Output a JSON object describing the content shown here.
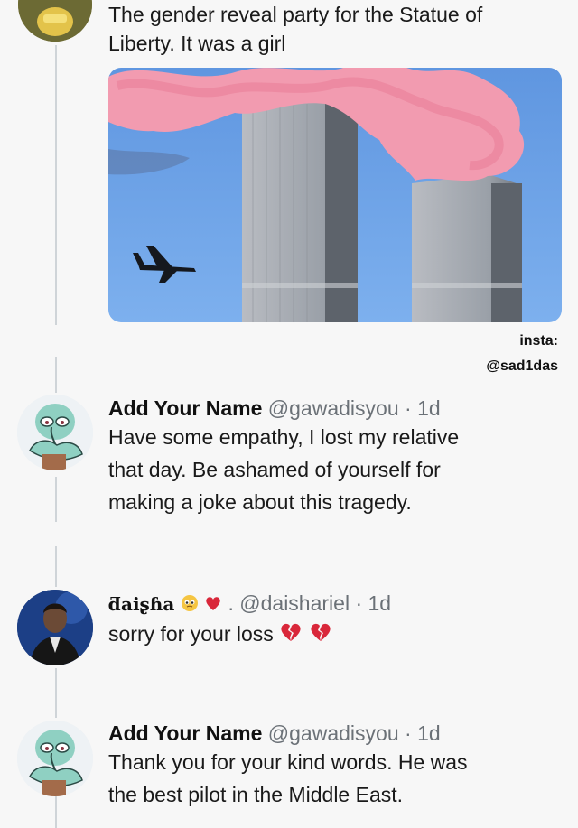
{
  "post": {
    "text_line1": "The gender reveal party for the Statue of",
    "text_line2": "Liberty. It was a girl",
    "image_alt": "twin towers with pink smoke and airplane"
  },
  "watermark": {
    "label": "insta:",
    "handle": "@sad1das"
  },
  "replies": [
    {
      "name": "Add Your Name",
      "handle": "@gawadisyou",
      "time": "· 1d",
      "lines": [
        "Have some empathy, I lost my relative",
        "that day.  Be ashamed of yourself for",
        "making a joke about this tragedy."
      ]
    },
    {
      "name": "ƌaiʂɦa",
      "handle": ". @daishariel",
      "time": "· 1d",
      "lines": [
        "sorry for your loss"
      ]
    },
    {
      "name": "Add Your Name",
      "handle": "@gawadisyou",
      "time": "· 1d",
      "lines": [
        "Thank you for your kind words. He was",
        "the best pilot in the Middle East."
      ]
    }
  ],
  "colors": {
    "sky": "#6fa3e6",
    "smoke": "#f08ea5",
    "handle": "#6b7177",
    "thread": "#cfd4d8"
  }
}
